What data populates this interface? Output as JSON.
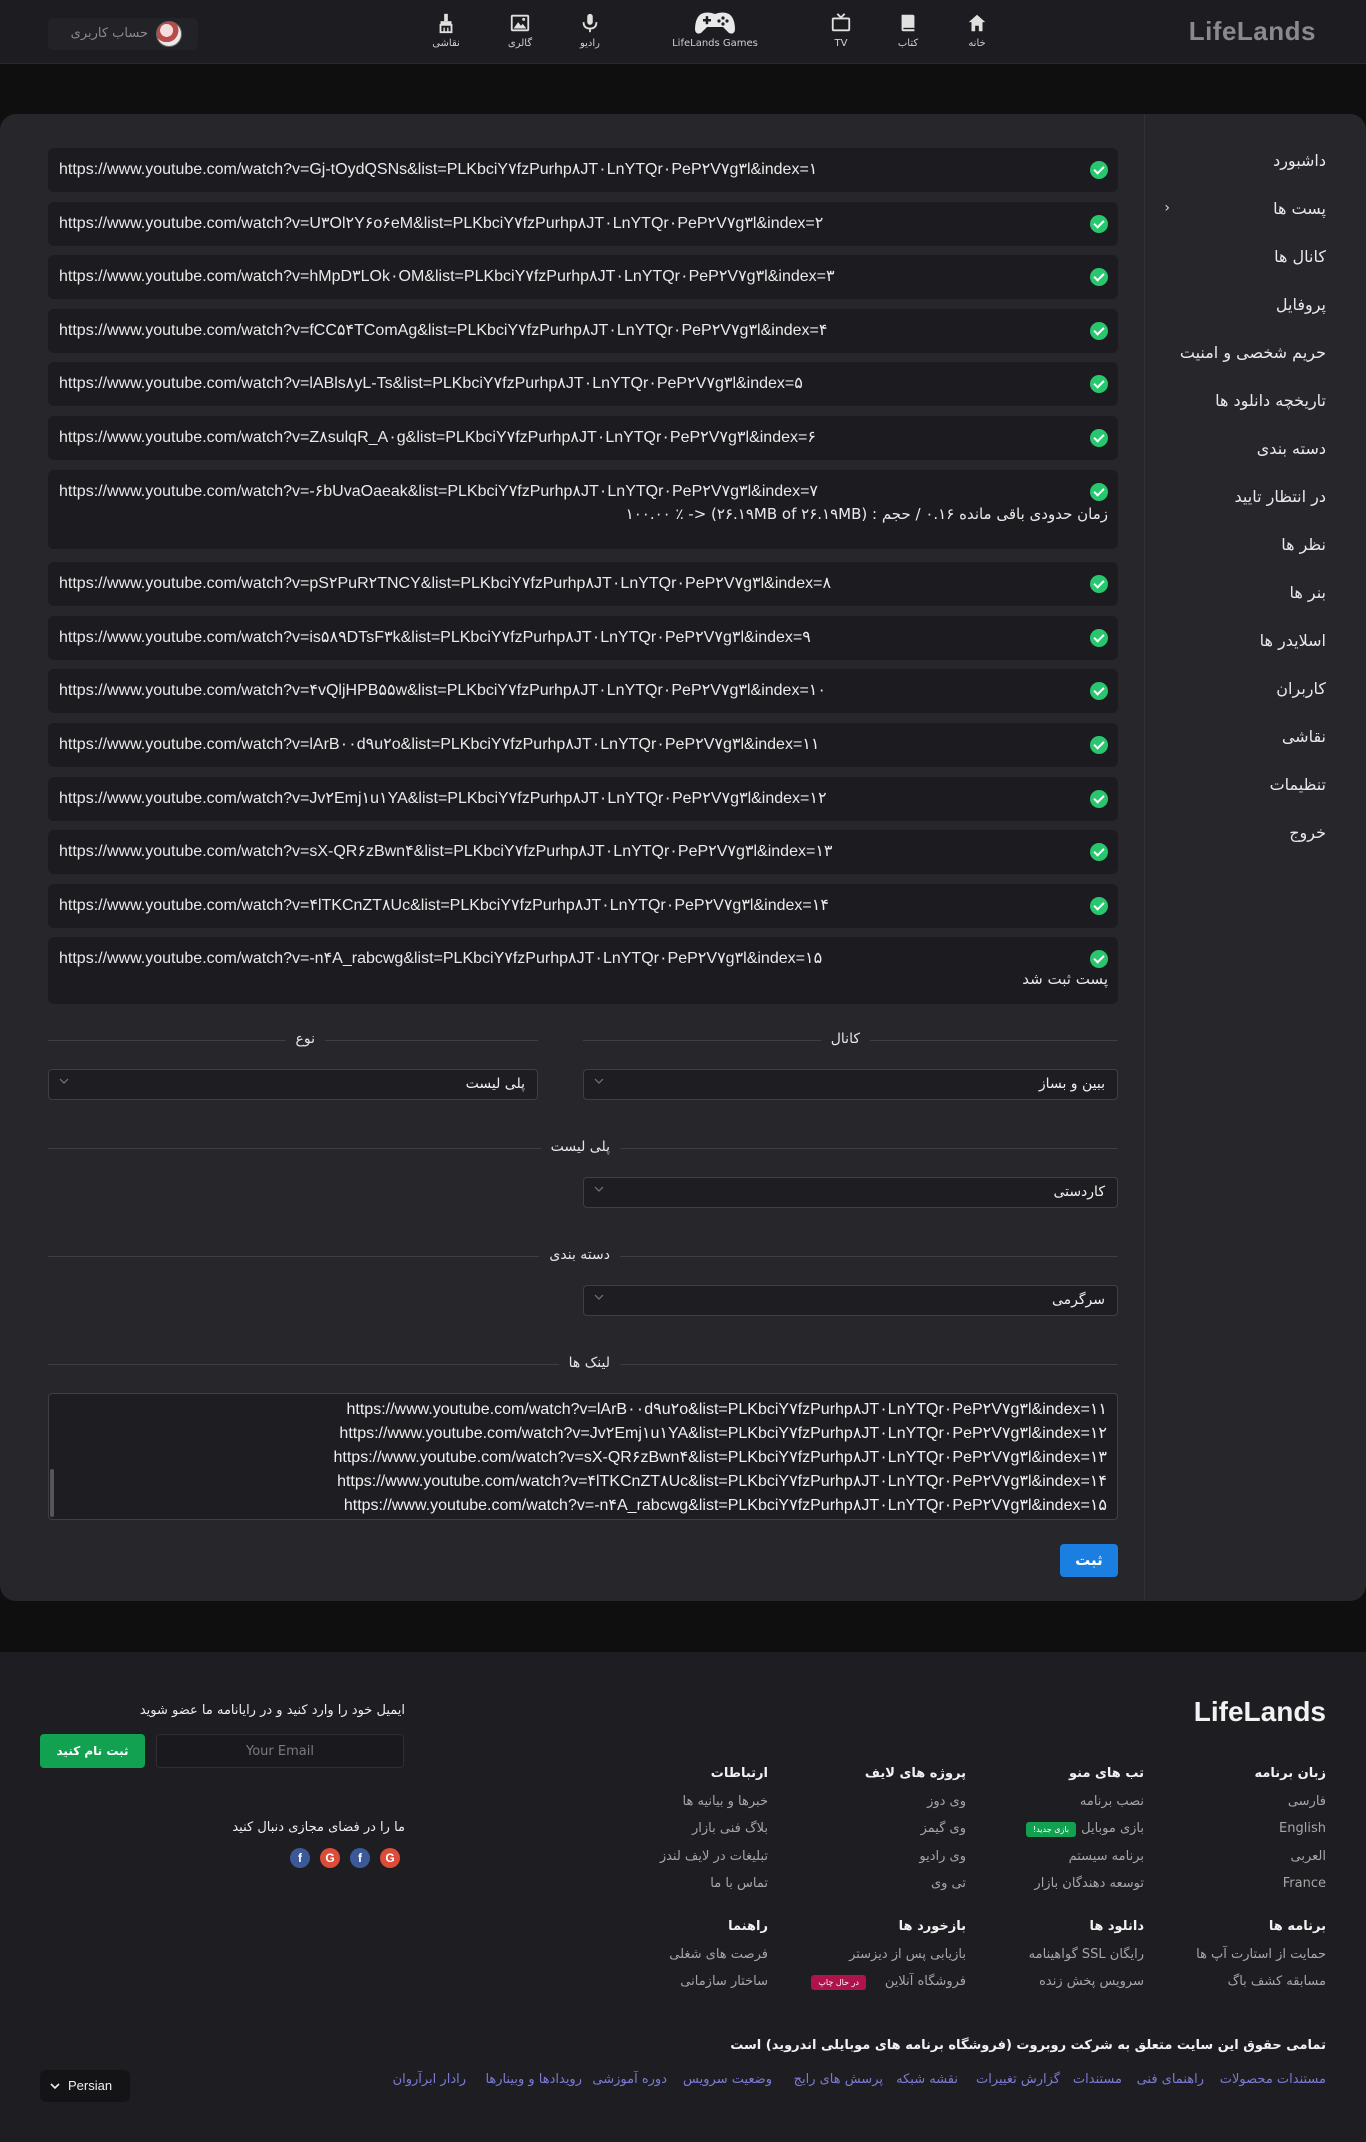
{
  "header": {
    "logo": "LifeLands",
    "nav": [
      {
        "label": "خانه",
        "icon": "home-icon"
      },
      {
        "label": "کتاب",
        "icon": "book-icon"
      },
      {
        "label": "TV",
        "icon": "tv-icon"
      },
      {
        "label": "LifeLands Games",
        "icon": "gamepad-icon"
      },
      {
        "label": "رادیو",
        "icon": "microphone-icon"
      },
      {
        "label": "گالری",
        "icon": "image-icon"
      },
      {
        "label": "نقاشی",
        "icon": "brush-icon"
      }
    ],
    "account_label": "حساب کاربری"
  },
  "sidebar": {
    "items": [
      "داشبورد",
      "پست ها",
      "کانال ها",
      "پروفایل",
      "حریم شخصی و امنیت",
      "تاریخچه دانلود ها",
      "دسته بندی",
      "در انتظار تایید",
      "نظر ها",
      "بنر ها",
      "اسلایدر ها",
      "کاربران",
      "نقاشی",
      "تنظیمات",
      "خروج"
    ]
  },
  "results": [
    {
      "url": "https://www.youtube.com/watch?v=Gj-tOydQSNs&list=PLKbciY۷fzPurhp۸JT۰LnYTQr۰PeP۲V۷g۳l&index=۱"
    },
    {
      "url": "https://www.youtube.com/watch?v=U۳Ol۲Y۶o۶eM&list=PLKbciY۷fzPurhp۸JT۰LnYTQr۰PeP۲V۷g۳l&index=۲"
    },
    {
      "url": "https://www.youtube.com/watch?v=hMpD۳LOk۰OM&list=PLKbciY۷fzPurhp۸JT۰LnYTQr۰PeP۲V۷g۳l&index=۳"
    },
    {
      "url": "https://www.youtube.com/watch?v=fCC۵۴TComAg&list=PLKbciY۷fzPurhp۸JT۰LnYTQr۰PeP۲V۷g۳l&index=۴"
    },
    {
      "url": "https://www.youtube.com/watch?v=lABls۸yL-Ts&list=PLKbciY۷fzPurhp۸JT۰LnYTQr۰PeP۲V۷g۳l&index=۵"
    },
    {
      "url": "https://www.youtube.com/watch?v=Z۸sulqR_A۰g&list=PLKbciY۷fzPurhp۸JT۰LnYTQr۰PeP۲V۷g۳l&index=۶"
    },
    {
      "url": "https://www.youtube.com/watch?v=-۶bUvaOaeak&list=PLKbciY۷fzPurhp۸JT۰LnYTQr۰PeP۲V۷g۳l&index=۷",
      "line2": "زمان حدودی باقی مانده ۰.۱۶ / حجم : (۲۶.۱۹MB of ۲۶.۱۹MB) <- ٪ ۱۰۰.۰۰"
    },
    {
      "url": "https://www.youtube.com/watch?v=pS۲PuR۲TNCY&list=PLKbciY۷fzPurhp۸JT۰LnYTQr۰PeP۲V۷g۳l&index=۸"
    },
    {
      "url": "https://www.youtube.com/watch?v=is۵۸۹DTsF۳k&list=PLKbciY۷fzPurhp۸JT۰LnYTQr۰PeP۲V۷g۳l&index=۹"
    },
    {
      "url": "https://www.youtube.com/watch?v=۴vQljHPB۵۵w&list=PLKbciY۷fzPurhp۸JT۰LnYTQr۰PeP۲V۷g۳l&index=۱۰"
    },
    {
      "url": "https://www.youtube.com/watch?v=lArB۰۰d۹u۲o&list=PLKbciY۷fzPurhp۸JT۰LnYTQr۰PeP۲V۷g۳l&index=۱۱"
    },
    {
      "url": "https://www.youtube.com/watch?v=Jv۲Emj۱u۱YA&list=PLKbciY۷fzPurhp۸JT۰LnYTQr۰PeP۲V۷g۳l&index=۱۲"
    },
    {
      "url": "https://www.youtube.com/watch?v=sX-QR۶zBwn۴&list=PLKbciY۷fzPurhp۸JT۰LnYTQr۰PeP۲V۷g۳l&index=۱۳"
    },
    {
      "url": "https://www.youtube.com/watch?v=۴lTKCnZT۸Uc&list=PLKbciY۷fzPurhp۸JT۰LnYTQr۰PeP۲V۷g۳l&index=۱۴"
    },
    {
      "url": "https://www.youtube.com/watch?v=-n۴A_rabcwg&list=PLKbciY۷fzPurhp۸JT۰LnYTQr۰PeP۲V۷g۳l&index=۱۵",
      "line2": "پست ثبت شد"
    }
  ],
  "form": {
    "channel_label": "کانال",
    "channel_value": "ببین و بساز",
    "type_label": "نوع",
    "type_value": "پلی لیست",
    "playlist_label": "پلی لیست",
    "playlist_value": "کاردستی",
    "category_label": "دسته بندی",
    "category_value": "سرگرمی",
    "links_label": "لینک ها",
    "links_lines": [
      "https://www.youtube.com/watch?v=lArB۰۰d۹u۲o&list=PLKbciY۷fzPurhp۸JT۰LnYTQr۰PeP۲V۷g۳l&index=۱۱",
      "https://www.youtube.com/watch?v=Jv۲Emj۱u۱YA&list=PLKbciY۷fzPurhp۸JT۰LnYTQr۰PeP۲V۷g۳l&index=۱۲",
      "https://www.youtube.com/watch?v=sX-QR۶zBwn۴&list=PLKbciY۷fzPurhp۸JT۰LnYTQr۰PeP۲V۷g۳l&index=۱۳",
      "https://www.youtube.com/watch?v=۴lTKCnZT۸Uc&list=PLKbciY۷fzPurhp۸JT۰LnYTQr۰PeP۲V۷g۳l&index=۱۴",
      "https://www.youtube.com/watch?v=-n۴A_rabcwg&list=PLKbciY۷fzPurhp۸JT۰LnYTQr۰PeP۲V۷g۳l&index=۱۵"
    ],
    "submit_label": "ثبت"
  },
  "footer": {
    "logo": "LifeLands",
    "columns_row1": [
      {
        "title": "زبان برنامه",
        "links": [
          "فارسی",
          "English",
          "العربی",
          "France"
        ]
      },
      {
        "title": "تب های منو",
        "links": [
          "نصب برنامه",
          "بازی موبایل",
          "برنامه سیستم",
          "توسعه دهندگان بازار"
        ],
        "badge": "بازی جدید!"
      },
      {
        "title": "پروژه های لایف",
        "links": [
          "وی دوز",
          "وی گیمز",
          "وی رادیو",
          "تی وی"
        ]
      },
      {
        "title": "ارتباطات",
        "links": [
          "خبرها و بیانیه ها",
          "بلاگ فنی بازار",
          "تبلیغات در لایف لندز",
          "تماس با ما"
        ]
      }
    ],
    "columns_row2": [
      {
        "title": "برنامه ها",
        "links": [
          "حمایت از استارت آپ ها",
          "مسابقه کشف باگ"
        ]
      },
      {
        "title": "دانلود ها",
        "links": [
          "رایگان SSL گواهینامه",
          "سرویس پخش زنده"
        ]
      },
      {
        "title": "بازخورد ها",
        "links": [
          "بازیابی پس از دیزستر",
          "فروشگاه آنلاین"
        ],
        "badge": "در حال چاپ"
      },
      {
        "title": "راهنما",
        "links": [
          "فرصت های شغلی",
          "ساختار سازمانی"
        ]
      }
    ],
    "newsletter_title": "ایمیل خود را وارد کنید و در رایانامه ما عضو شوید",
    "email_placeholder": "Your Email",
    "join_label": "ثبت نام کنید",
    "social_title": "ما را در فضای مجازی دنبال کنید",
    "social": [
      "facebook-icon",
      "google-plus-icon",
      "facebook-icon",
      "google-plus-icon"
    ],
    "copyright": "تمامی حقوق این سایت متعلق به شرکت روبروت (فروشگاه برنامه های موبایلی اندروید) است",
    "bottom_links": [
      "مستندات محصولات",
      "راهنمای فنی",
      "مستندات",
      "گزارش تغییرات",
      "نقشه شبکه",
      "پرسش های رایج",
      "وضعیت سرویس",
      "دوره آموزشی",
      "رویدادها و وبینارها",
      "رادار ابرآروان"
    ],
    "language": "Persian"
  },
  "colors": {
    "accent": "#1a7fe0",
    "success": "#28c76f",
    "join": "#12a150",
    "link": "#7b7bd6"
  }
}
